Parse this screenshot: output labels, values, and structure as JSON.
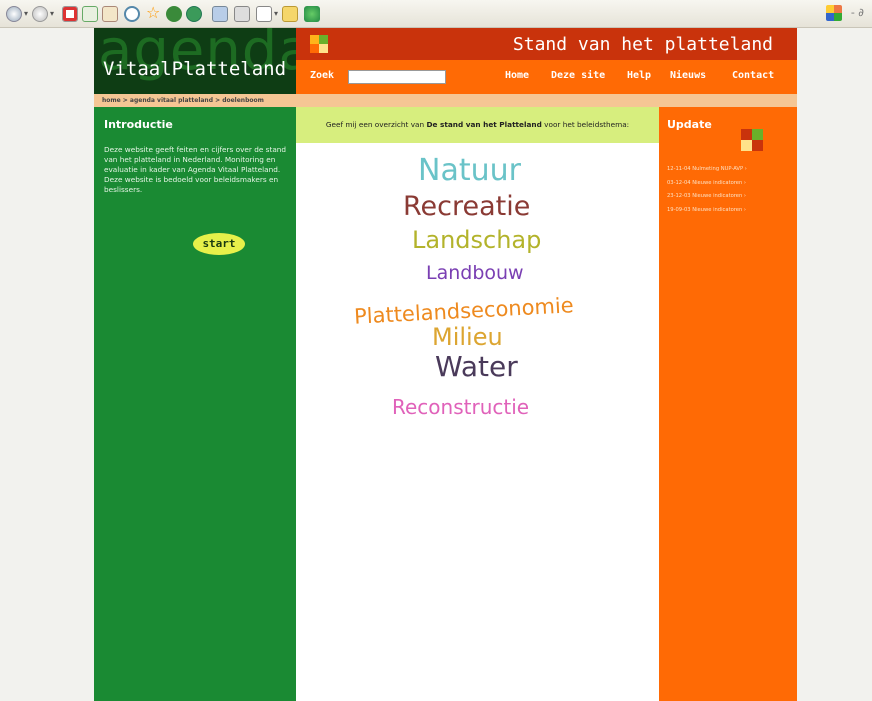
{
  "browser": {
    "window_controls": "- ∂",
    "toolbar_icons": [
      "back-icon",
      "forward-icon",
      "stop-icon",
      "refresh-icon",
      "home-icon",
      "search-icon",
      "favorites-icon",
      "media-icon",
      "history-icon",
      "mail-icon",
      "print-icon",
      "edit-icon",
      "folder-icon",
      "messenger-icon"
    ]
  },
  "site": {
    "logo_bg_word": "agenda",
    "logo_text": "VitaalPlatteland",
    "title": "Stand van het platteland",
    "search_label": "Zoek",
    "search_value": "",
    "nav": [
      "Home",
      "Deze site",
      "Help",
      "Nieuws",
      "Contact"
    ],
    "breadcrumb": "home > agenda vitaal platteland > doelenboom"
  },
  "intro": {
    "title": "Introductie",
    "text": "Deze website geeft feiten en cijfers over de stand van het platteland in Nederland. Monitoring en evaluatie in kader van Agenda Vitaal Platteland. Deze website is bedoeld voor beleidsmakers en beslissers.",
    "start_label": "start"
  },
  "center": {
    "prompt_before": "Geef mij een overzicht van ",
    "prompt_bold": "De stand van het Platteland",
    "prompt_after": " voor het beleidsthema:",
    "themes": [
      {
        "label": "Natuur",
        "color": "#6ac3c8"
      },
      {
        "label": "Recreatie",
        "color": "#8a3a34"
      },
      {
        "label": "Landschap",
        "color": "#b3b32b"
      },
      {
        "label": "Landbouw",
        "color": "#7a3fb3"
      },
      {
        "label": "Plattelandseconomie",
        "color": "#ee8a1f"
      },
      {
        "label": "Milieu",
        "color": "#dca531"
      },
      {
        "label": "Water",
        "color": "#4a3a5a"
      },
      {
        "label": "Reconstructie",
        "color": "#e062ba"
      }
    ]
  },
  "update": {
    "title": "Update",
    "items": [
      "12-11-04 Nulmeting NUP-AVP ›",
      "03-12-04 Nieuwe indicatoren ›",
      "23-12-03 Nieuwe indicatoren ›",
      "19-09-03 Nieuwe indicatoren ›"
    ]
  },
  "colors": {
    "logo_bg": "#0e3d14",
    "header_red": "#c9330c",
    "header_orange": "#ff6a05",
    "left_green": "#1a8a33",
    "prompt_green": "#d7ee7e",
    "start_yellow": "#e7f04a"
  }
}
